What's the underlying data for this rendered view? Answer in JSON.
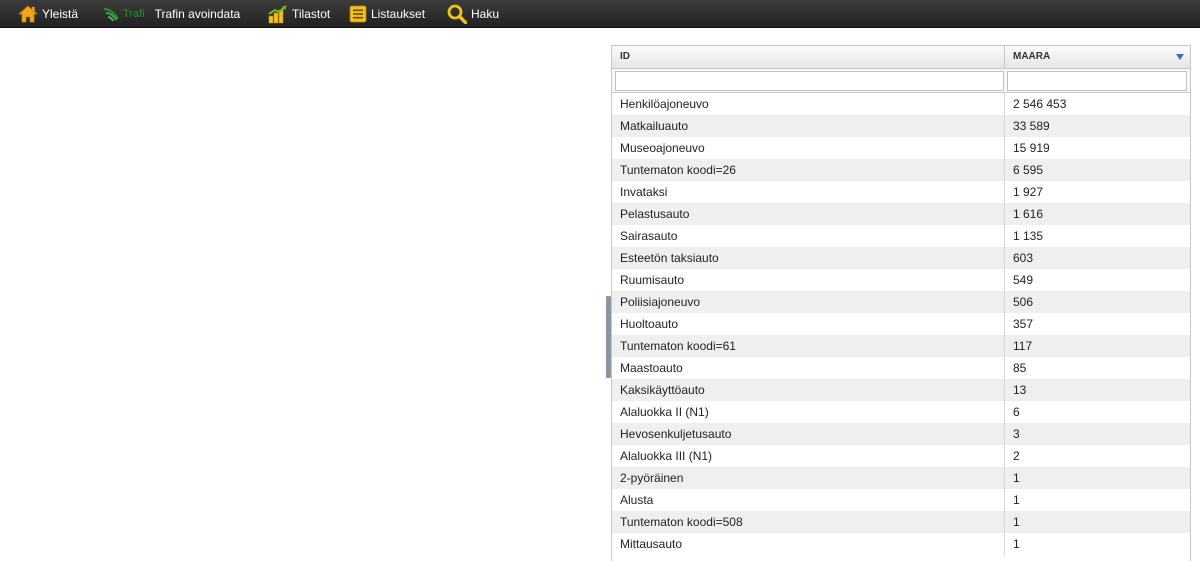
{
  "nav": {
    "items": [
      {
        "label": "Yleistä",
        "icon": "home-icon"
      },
      {
        "label": "Trafi",
        "label2": "Trafin avoindata",
        "icon": "trafi-logo-icon"
      },
      {
        "label": "Tilastot",
        "icon": "chart-icon"
      },
      {
        "label": "Listaukset",
        "icon": "list-icon"
      },
      {
        "label": "Haku",
        "icon": "search-icon"
      }
    ]
  },
  "grid": {
    "columns": {
      "id": "ID",
      "maara": "MAARA"
    },
    "filter": {
      "id": "",
      "maara": ""
    },
    "rows": [
      {
        "id": "Henkilöajoneuvo",
        "maara": "2 546 453"
      },
      {
        "id": "Matkailuauto",
        "maara": "33 589"
      },
      {
        "id": "Museoajoneuvo",
        "maara": "15 919"
      },
      {
        "id": "Tuntematon koodi=26",
        "maara": "6 595"
      },
      {
        "id": "Invataksi",
        "maara": "1 927"
      },
      {
        "id": "Pelastusauto",
        "maara": "1 616"
      },
      {
        "id": "Sairasauto",
        "maara": "1 135"
      },
      {
        "id": "Esteetön taksiauto",
        "maara": "603"
      },
      {
        "id": "Ruumisauto",
        "maara": "549"
      },
      {
        "id": "Poliisiajoneuvo",
        "maara": "506"
      },
      {
        "id": "Huoltoauto",
        "maara": "357"
      },
      {
        "id": "Tuntematon koodi=61",
        "maara": "117"
      },
      {
        "id": "Maastoauto",
        "maara": "85"
      },
      {
        "id": "Kaksikäyttöauto",
        "maara": "13"
      },
      {
        "id": "Alaluokka II (N1)",
        "maara": "6"
      },
      {
        "id": "Hevosenkuljetusauto",
        "maara": "3"
      },
      {
        "id": "Alaluokka III (N1)",
        "maara": "2"
      },
      {
        "id": "2-pyöräinen",
        "maara": "1"
      },
      {
        "id": "Alusta",
        "maara": "1"
      },
      {
        "id": "Tuntematon koodi=508",
        "maara": "1"
      },
      {
        "id": "Mittausauto",
        "maara": "1"
      }
    ]
  },
  "colors": {
    "topbar": "#2e2e2e",
    "accent_orange": "#f2a51a",
    "accent_yellow": "#f2c21a",
    "trafi_green": "#2f8a2f",
    "sort_arrow": "#3a6fb8",
    "row_alt": "#efefef"
  }
}
